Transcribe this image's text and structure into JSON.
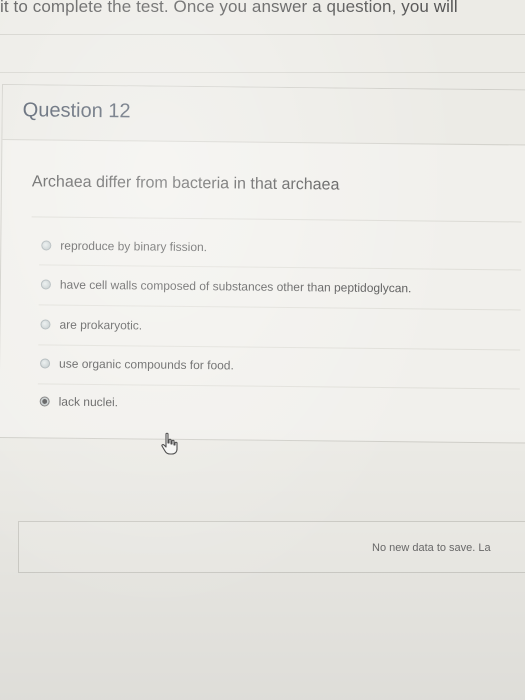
{
  "instructions": {
    "text": "it to complete the test. Once you answer a question, you will"
  },
  "question": {
    "title": "Question 12",
    "prompt": "Archaea differ from bacteria in that archaea",
    "options": [
      {
        "label": "reproduce by binary fission.",
        "selected": false
      },
      {
        "label": "have cell walls composed of substances other than peptidoglycan.",
        "selected": false
      },
      {
        "label": "are prokaryotic.",
        "selected": false
      },
      {
        "label": "use organic compounds for food.",
        "selected": false
      },
      {
        "label": "lack nuclei.",
        "selected": true
      }
    ]
  },
  "save_bar": {
    "status": "No new data to save. La"
  },
  "icons": {
    "cursor": "hand-pointer-icon",
    "radio": "radio-button"
  },
  "colors": {
    "background": "#ecebe6",
    "title": "#4d5766",
    "text": "#555555"
  }
}
